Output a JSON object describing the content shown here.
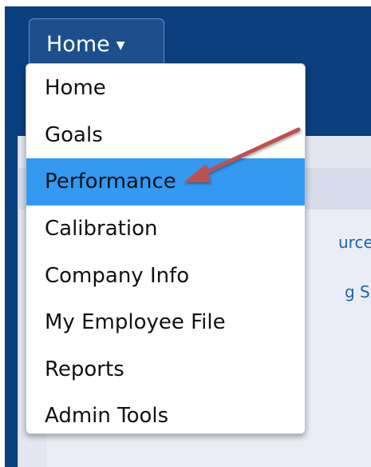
{
  "nav": {
    "home_button_label": "Home",
    "menu_items": [
      {
        "label": "Home",
        "active": false
      },
      {
        "label": "Goals",
        "active": false
      },
      {
        "label": "Performance",
        "active": true
      },
      {
        "label": "Calibration",
        "active": false
      },
      {
        "label": "Company Info",
        "active": false
      },
      {
        "label": "My Employee File",
        "active": false
      },
      {
        "label": "Reports",
        "active": false
      },
      {
        "label": "Admin Tools",
        "active": false
      }
    ]
  },
  "background": {
    "link_fragment_1": "urce",
    "link_fragment_2": "g So"
  },
  "colors": {
    "nav_background": "#0b3f7e",
    "highlight": "#3399f3",
    "annotation_arrow": "#c0504d"
  },
  "icons": {
    "caret": "chevron-down-icon",
    "annotation": "arrow-annotation-icon"
  }
}
